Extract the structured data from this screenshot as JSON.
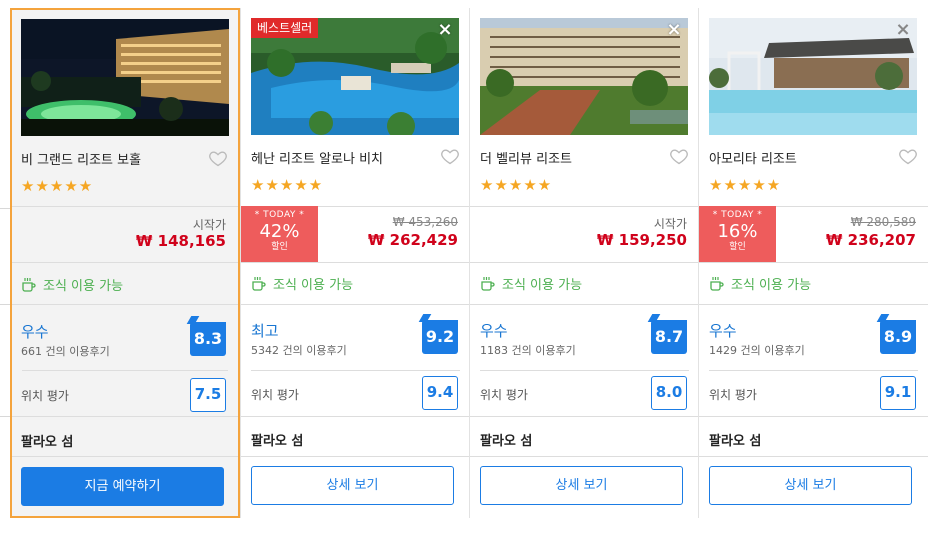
{
  "colors": {
    "accent": "#1b7ce4",
    "price_red": "#d0021b",
    "today_bg": "#ee5c5c",
    "stars": "#f5a623",
    "breakfast_green": "#4caf50",
    "selected_border": "#f4a33c"
  },
  "hotels": [
    {
      "name": "비 그랜드 리조트 보홀",
      "stars": "★★★★★",
      "price_label": "시작가",
      "price": "₩ 148,165",
      "breakfast": "조식 이용 가능",
      "rating_word": "우수",
      "reviews": "661 건의 이용후기",
      "score": "8.3",
      "location_label": "위치 평가",
      "location_score": "7.5",
      "area": "팔라오 섬",
      "button": "지금 예약하기"
    },
    {
      "name": "헤난 리조트 알로나 비치",
      "badge": "베스트셀러",
      "stars": "★★★★★",
      "today_label": "* TODAY *",
      "discount": "42%",
      "discount_sub": "할인",
      "original_price": "₩ 453,260",
      "price": "₩ 262,429",
      "breakfast": "조식 이용 가능",
      "rating_word": "최고",
      "reviews": "5342 건의 이용후기",
      "score": "9.2",
      "location_label": "위치 평가",
      "location_score": "9.4",
      "area": "팔라오 섬",
      "button": "상세 보기"
    },
    {
      "name": "더 벨리뷰 리조트",
      "stars": "★★★★★",
      "price_label": "시작가",
      "price": "₩ 159,250",
      "breakfast": "조식 이용 가능",
      "rating_word": "우수",
      "reviews": "1183 건의 이용후기",
      "score": "8.7",
      "location_label": "위치 평가",
      "location_score": "8.0",
      "area": "팔라오 섬",
      "button": "상세 보기"
    },
    {
      "name": "아모리타 리조트",
      "stars": "★★★★★",
      "today_label": "* TODAY *",
      "discount": "16%",
      "discount_sub": "할인",
      "original_price": "₩ 280,589",
      "price": "₩ 236,207",
      "breakfast": "조식 이용 가능",
      "rating_word": "우수",
      "reviews": "1429 건의 이용후기",
      "score": "8.9",
      "location_label": "위치 평가",
      "location_score": "9.1",
      "area": "팔라오 섬",
      "button": "상세 보기"
    }
  ],
  "icons": {
    "close": "×",
    "heart": "heart-outline-icon",
    "coffee": "coffee-cup-icon"
  }
}
